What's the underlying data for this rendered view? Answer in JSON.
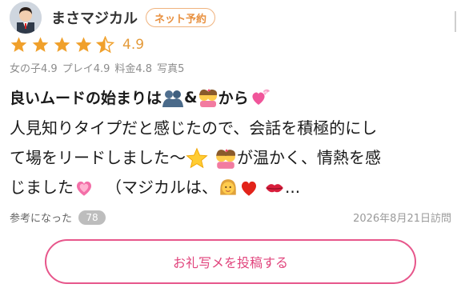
{
  "reviewer": {
    "name": "まさマジカル",
    "badge": "ネット予約"
  },
  "rating": {
    "stars": 4.5,
    "value": "4.9",
    "subscores": [
      "女の子4.9",
      "プレイ4.9",
      "料金4.8",
      "写真5"
    ]
  },
  "review": {
    "title_before": "良いムードの始まりは",
    "title_amp": "&",
    "title_after": "から",
    "line1": "人見知りタイプだと感じたので、会話を積極的にし",
    "line2_before": "て場をリードしました〜",
    "line2_after": "が温かく、情熱を感",
    "line3_before": "じました",
    "line3_middle": "（マジカルは、",
    "line3_after": "..."
  },
  "footer": {
    "helpful_label": "参考になった",
    "helpful_count": "78",
    "visit_date": "2026年8月21日訪問"
  },
  "actions": {
    "post_photo_label": "お礼写メを投稿する"
  },
  "colors": {
    "star": "#f0a02b",
    "accent_pink": "#e7568b",
    "badge_orange": "#e8903f"
  },
  "icons": [
    "avatar",
    "star-icon",
    "star-half-icon",
    "people-hugging-icon",
    "couple-icon",
    "heart-ribbon-icon",
    "star-emoji-icon",
    "growing-heart-icon",
    "woman-icon",
    "red-heart-icon",
    "kiss-icon"
  ]
}
